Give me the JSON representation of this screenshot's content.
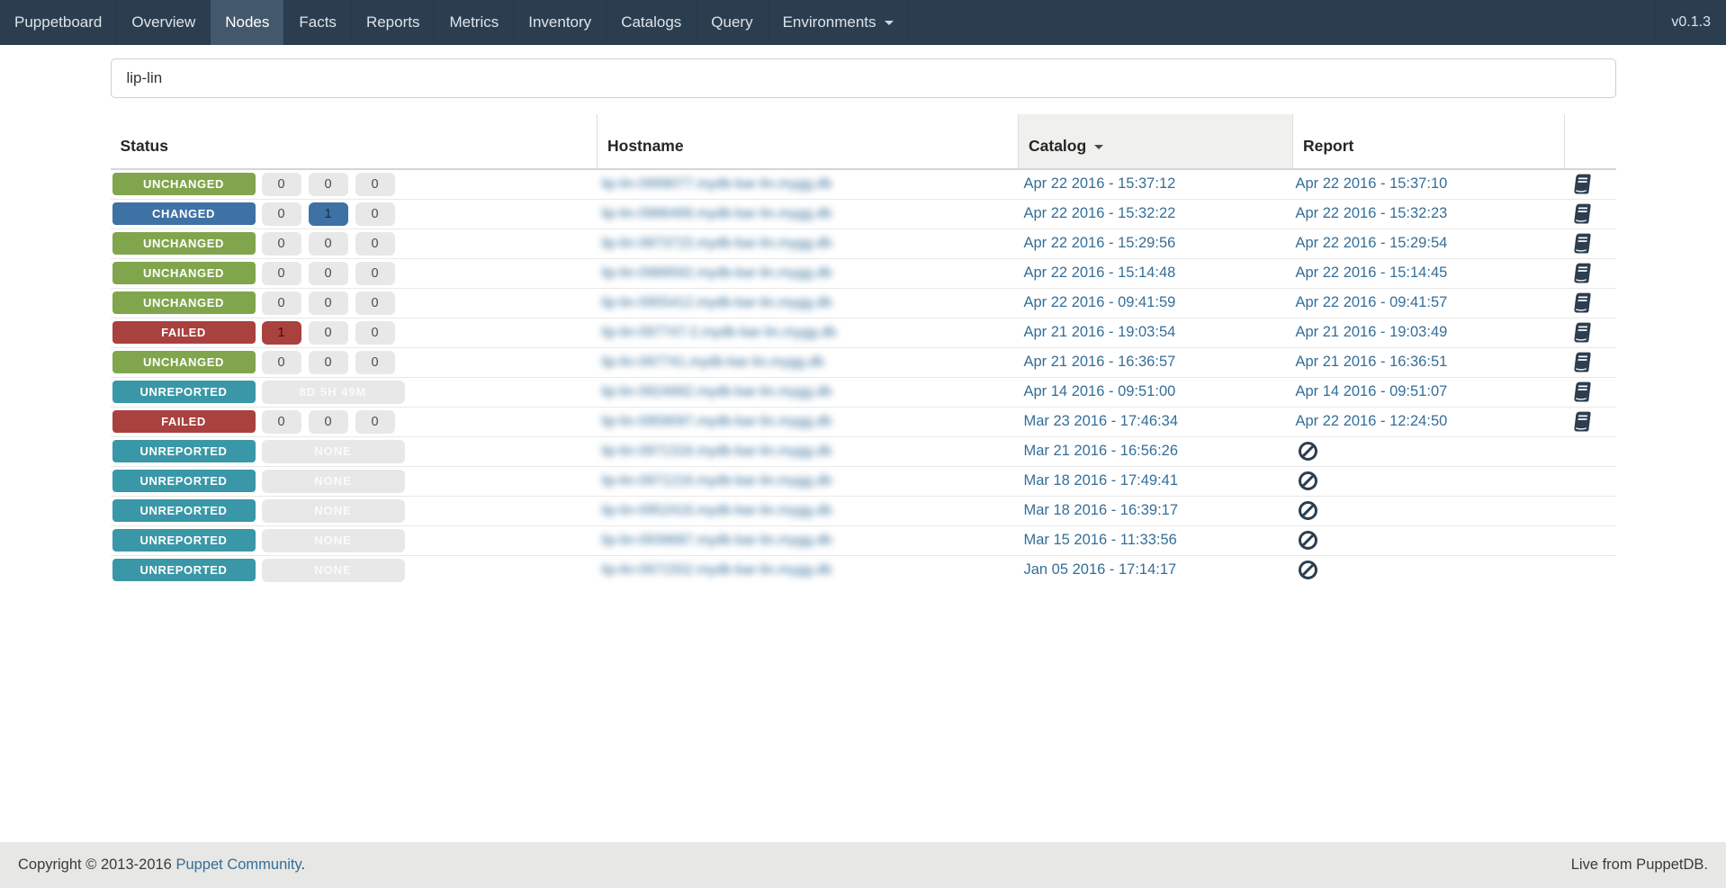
{
  "colors": {
    "navbar_bg": "#2b3e50",
    "navbar_active": "#44586c",
    "green": "#80a54c",
    "blue": "#3e72a5",
    "red": "#a9413e",
    "teal": "#3a97a7",
    "link": "#356e98",
    "count_bg": "#e8e8e8"
  },
  "navbar": {
    "items": [
      {
        "label": "Puppetboard",
        "active": false,
        "caret": false
      },
      {
        "label": "Overview",
        "active": false,
        "caret": false
      },
      {
        "label": "Nodes",
        "active": true,
        "caret": false
      },
      {
        "label": "Facts",
        "active": false,
        "caret": false
      },
      {
        "label": "Reports",
        "active": false,
        "caret": false
      },
      {
        "label": "Metrics",
        "active": false,
        "caret": false
      },
      {
        "label": "Inventory",
        "active": false,
        "caret": false
      },
      {
        "label": "Catalogs",
        "active": false,
        "caret": false
      },
      {
        "label": "Query",
        "active": false,
        "caret": false
      },
      {
        "label": "Environments",
        "active": false,
        "caret": true
      }
    ],
    "version": "v0.1.3"
  },
  "search": {
    "value": "lip-lin"
  },
  "table": {
    "headers": {
      "status": "Status",
      "hostname": "Hostname",
      "catalog": "Catalog",
      "report": "Report"
    },
    "sorted_column": "catalog",
    "sort_direction": "desc",
    "rows": [
      {
        "status": "UNCHANGED",
        "status_key": "unchanged",
        "counts": [
          {
            "value": "0",
            "variant": "default"
          },
          {
            "value": "0",
            "variant": "default"
          },
          {
            "value": "0",
            "variant": "default"
          }
        ],
        "duration": null,
        "hostname_blurred": "lip-lin-0999077.mydb-bar-lin.mygg.db",
        "catalog": "Apr 22 2016 - 15:37:12",
        "report": "Apr 22 2016 - 15:37:10",
        "report_icon": "book"
      },
      {
        "status": "CHANGED",
        "status_key": "changed",
        "counts": [
          {
            "value": "0",
            "variant": "default"
          },
          {
            "value": "1",
            "variant": "changed"
          },
          {
            "value": "0",
            "variant": "default"
          }
        ],
        "duration": null,
        "hostname_blurred": "lip-lin-0986499.mydb-bar-lin.mygg.db",
        "catalog": "Apr 22 2016 - 15:32:22",
        "report": "Apr 22 2016 - 15:32:23",
        "report_icon": "book"
      },
      {
        "status": "UNCHANGED",
        "status_key": "unchanged",
        "counts": [
          {
            "value": "0",
            "variant": "default"
          },
          {
            "value": "0",
            "variant": "default"
          },
          {
            "value": "0",
            "variant": "default"
          }
        ],
        "duration": null,
        "hostname_blurred": "lip-lin-0873715.mydb-bar-lin.mygg.db",
        "catalog": "Apr 22 2016 - 15:29:56",
        "report": "Apr 22 2016 - 15:29:54",
        "report_icon": "book"
      },
      {
        "status": "UNCHANGED",
        "status_key": "unchanged",
        "counts": [
          {
            "value": "0",
            "variant": "default"
          },
          {
            "value": "0",
            "variant": "default"
          },
          {
            "value": "0",
            "variant": "default"
          }
        ],
        "duration": null,
        "hostname_blurred": "lip-lin-0989592.mydb-bar-lin.mygg.db",
        "catalog": "Apr 22 2016 - 15:14:48",
        "report": "Apr 22 2016 - 15:14:45",
        "report_icon": "book"
      },
      {
        "status": "UNCHANGED",
        "status_key": "unchanged",
        "counts": [
          {
            "value": "0",
            "variant": "default"
          },
          {
            "value": "0",
            "variant": "default"
          },
          {
            "value": "0",
            "variant": "default"
          }
        ],
        "duration": null,
        "hostname_blurred": "lip-lin-0955412.mydb-bar-lin.mygg.db",
        "catalog": "Apr 22 2016 - 09:41:59",
        "report": "Apr 22 2016 - 09:41:57",
        "report_icon": "book"
      },
      {
        "status": "FAILED",
        "status_key": "failed",
        "counts": [
          {
            "value": "1",
            "variant": "failed"
          },
          {
            "value": "0",
            "variant": "default"
          },
          {
            "value": "0",
            "variant": "default"
          }
        ],
        "duration": null,
        "hostname_blurred": "lip-lin-097747-2.mydb-bar-lin.mygg.db",
        "catalog": "Apr 21 2016 - 19:03:54",
        "report": "Apr 21 2016 - 19:03:49",
        "report_icon": "book"
      },
      {
        "status": "UNCHANGED",
        "status_key": "unchanged",
        "counts": [
          {
            "value": "0",
            "variant": "default"
          },
          {
            "value": "0",
            "variant": "default"
          },
          {
            "value": "0",
            "variant": "default"
          }
        ],
        "duration": null,
        "hostname_blurred": "lip-lin-097741.mydb-bar-lin.mygg.db",
        "catalog": "Apr 21 2016 - 16:36:57",
        "report": "Apr 21 2016 - 16:36:51",
        "report_icon": "book"
      },
      {
        "status": "UNREPORTED",
        "status_key": "unreported",
        "counts": [],
        "duration": "8D 5H 49M",
        "hostname_blurred": "lip-lin-0924992.mydb-bar-lin.mygg.db",
        "catalog": "Apr 14 2016 - 09:51:00",
        "report": "Apr 14 2016 - 09:51:07",
        "report_icon": "book"
      },
      {
        "status": "FAILED",
        "status_key": "failed",
        "counts": [
          {
            "value": "0",
            "variant": "default"
          },
          {
            "value": "0",
            "variant": "default"
          },
          {
            "value": "0",
            "variant": "default"
          }
        ],
        "duration": null,
        "hostname_blurred": "lip-lin-0959097.mydb-bar-lin.mygg.db",
        "catalog": "Mar 23 2016 - 17:46:34",
        "report": "Apr 22 2016 - 12:24:50",
        "report_icon": "book"
      },
      {
        "status": "UNREPORTED",
        "status_key": "unreported",
        "counts": [],
        "duration": "NONE",
        "hostname_blurred": "lip-lin-0971316.mydb-bar-lin.mygg.db",
        "catalog": "Mar 21 2016 - 16:56:26",
        "report": null,
        "report_icon": "ban"
      },
      {
        "status": "UNREPORTED",
        "status_key": "unreported",
        "counts": [],
        "duration": "NONE",
        "hostname_blurred": "lip-lin-0971216.mydb-bar-lin.mygg.db",
        "catalog": "Mar 18 2016 - 17:49:41",
        "report": null,
        "report_icon": "ban"
      },
      {
        "status": "UNREPORTED",
        "status_key": "unreported",
        "counts": [],
        "duration": "NONE",
        "hostname_blurred": "lip-lin-0952416.mydb-bar-lin.mygg.db",
        "catalog": "Mar 18 2016 - 16:39:17",
        "report": null,
        "report_icon": "ban"
      },
      {
        "status": "UNREPORTED",
        "status_key": "unreported",
        "counts": [],
        "duration": "NONE",
        "hostname_blurred": "lip-lin-0939687.mydb-bar-lin.mygg.db",
        "catalog": "Mar 15 2016 - 11:33:56",
        "report": null,
        "report_icon": "ban"
      },
      {
        "status": "UNREPORTED",
        "status_key": "unreported",
        "counts": [],
        "duration": "NONE",
        "hostname_blurred": "lip-lin-0971552.mydb-bar-lin.mygg.db",
        "catalog": "Jan 05 2016 - 17:14:17",
        "report": null,
        "report_icon": "ban"
      }
    ]
  },
  "footer": {
    "copyright_prefix": "Copyright © 2013-2016 ",
    "copyright_link": "Puppet Community",
    "copyright_suffix": ".",
    "right": "Live from PuppetDB."
  }
}
